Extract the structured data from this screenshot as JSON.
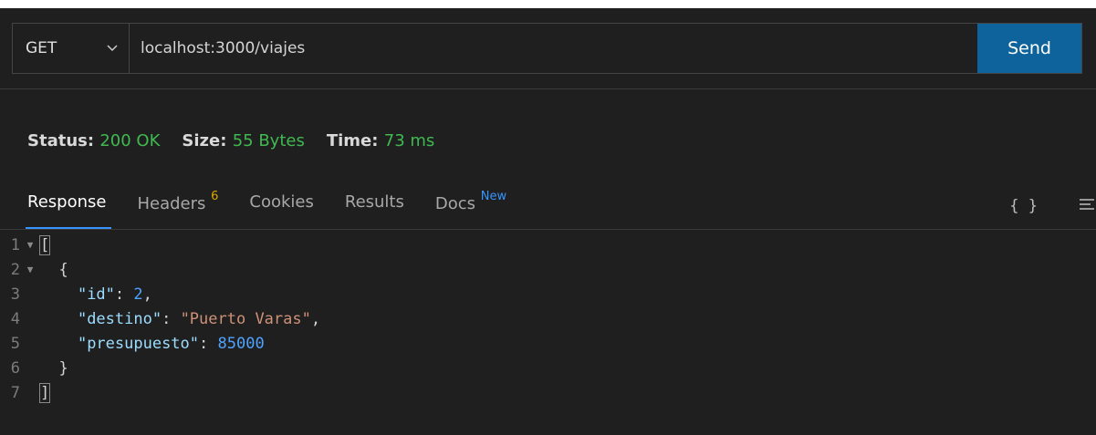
{
  "request": {
    "method": "GET",
    "url": "localhost:3000/viajes",
    "send_label": "Send"
  },
  "status": {
    "status_label": "Status:",
    "status_value": "200 OK",
    "size_label": "Size:",
    "size_value": "55 Bytes",
    "time_label": "Time:",
    "time_value": "73 ms"
  },
  "tabs": [
    {
      "label": "Response",
      "badge": ""
    },
    {
      "label": "Headers",
      "badge": "6"
    },
    {
      "label": "Cookies",
      "badge": ""
    },
    {
      "label": "Results",
      "badge": ""
    },
    {
      "label": "Docs",
      "badge": "New"
    }
  ],
  "tools": {
    "braces": "{ }",
    "wrap_icon": "wrap-lines-icon"
  },
  "code": {
    "line_numbers": [
      "1",
      "2",
      "3",
      "4",
      "5",
      "6",
      "7"
    ],
    "open_bracket": "[",
    "open_brace": "{",
    "key_id": "\"id\"",
    "val_id": "2",
    "key_destino": "\"destino\"",
    "val_destino": "\"Puerto Varas\"",
    "key_presupuesto": "\"presupuesto\"",
    "val_presupuesto": "85000",
    "close_brace": "}",
    "close_bracket": "]"
  },
  "colors": {
    "background": "#1f1f1f",
    "accent": "#0e639c",
    "status_green": "#3fb950",
    "tab_underline": "#3794ff"
  }
}
